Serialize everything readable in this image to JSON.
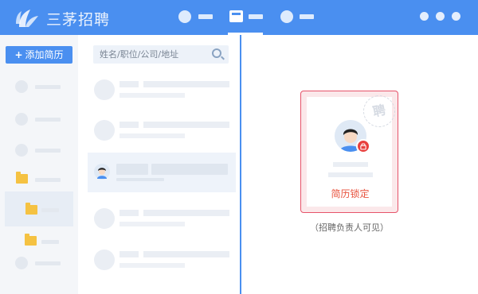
{
  "app": {
    "brand": "三茅招聘",
    "accent_color": "#4a8ff0"
  },
  "topnav": {
    "items": [
      {
        "icon": "circle-icon",
        "active": false
      },
      {
        "icon": "inbox-icon",
        "active": true
      },
      {
        "icon": "circle-icon",
        "active": false
      }
    ],
    "window_controls": [
      "dot",
      "dot",
      "dot"
    ]
  },
  "sidebar": {
    "add_button_label": "添加简历",
    "add_button_icon": "plus",
    "rows": [
      {
        "icon": "circle",
        "selected": false
      },
      {
        "icon": "circle",
        "selected": false
      },
      {
        "icon": "circle",
        "selected": false
      },
      {
        "icon": "folder-icon",
        "selected": false
      },
      {
        "icon": "folder-icon",
        "selected": true
      },
      {
        "icon": "folder-icon",
        "selected": false
      },
      {
        "icon": "circle",
        "selected": false
      }
    ]
  },
  "list": {
    "search_placeholder": "姓名/职位/公司/地址",
    "items": [
      {
        "placeholder": true
      },
      {
        "placeholder": true
      },
      {
        "selected": true,
        "blurred": true
      },
      {
        "placeholder": true
      },
      {
        "placeholder": true
      }
    ]
  },
  "detail": {
    "stamp_text": "聘",
    "status_label": "简历锁定",
    "note": "（招聘负责人可见）",
    "card_border_color": "#e6536a",
    "status_color": "#e8533e"
  }
}
